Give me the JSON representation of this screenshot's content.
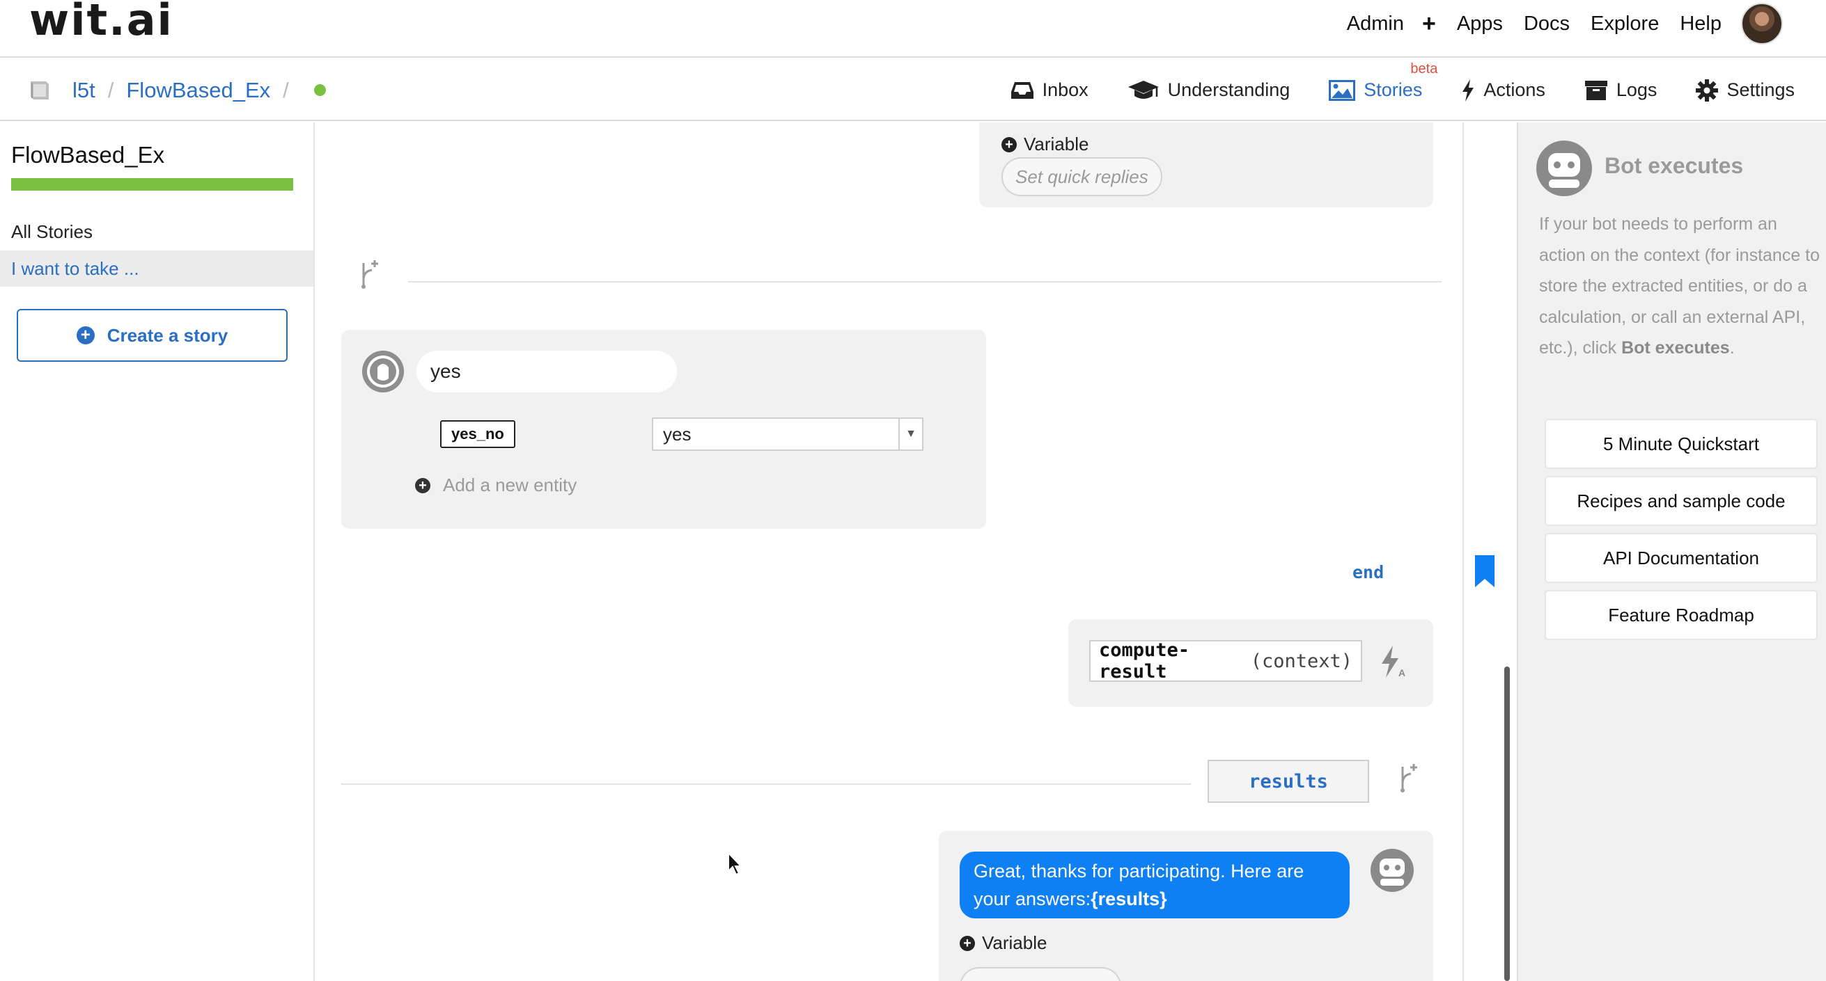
{
  "app": {
    "logo": "wit.ai"
  },
  "topnav": {
    "admin": "Admin",
    "plus": "+",
    "apps": "Apps",
    "docs": "Docs",
    "explore": "Explore",
    "help": "Help"
  },
  "breadcrumb": {
    "owner": "l5t",
    "separator": "/",
    "app": "FlowBased_Ex",
    "status_color": "#7ac142"
  },
  "tabs": {
    "inbox": "Inbox",
    "understanding": "Understanding",
    "stories": "Stories",
    "stories_badge": "beta",
    "actions": "Actions",
    "logs": "Logs",
    "settings": "Settings",
    "active": "stories"
  },
  "sidebar": {
    "title": "FlowBased_Ex",
    "progress": 1.0,
    "all_stories": "All Stories",
    "stories": [
      {
        "label": "I want to take ...",
        "selected": true
      }
    ],
    "create_button": "Create a story"
  },
  "story": {
    "top_variable_label": "Variable",
    "top_quick_replies_placeholder": "Set quick replies",
    "user_turn": {
      "text": "yes",
      "entities": [
        {
          "name": "yes_no",
          "value": "yes"
        }
      ],
      "add_entity": "Add a new entity"
    },
    "bookmark_label": "end",
    "action": {
      "name": "compute-result",
      "arg": "(context)"
    },
    "context_key": "results",
    "bot_response": {
      "text": "Great, thanks for participating. Here are your answers:",
      "var": "{results}"
    },
    "bottom_variable_label": "Variable"
  },
  "help_panel": {
    "title": "Bot executes",
    "desc_text": "If your bot needs to perform an action on the context (for instance to store the extracted entities, or do a calculation, or call an external API, etc.), click",
    "desc_bold": "Bot executes",
    "desc_end": ".",
    "links": [
      "5 Minute Quickstart",
      "Recipes and sample code",
      "API Documentation",
      "Feature Roadmap"
    ]
  },
  "colors": {
    "accent": "#2b6fc4",
    "bubble": "#0f80f3",
    "success": "#7ac142",
    "badge": "#e2503d"
  }
}
